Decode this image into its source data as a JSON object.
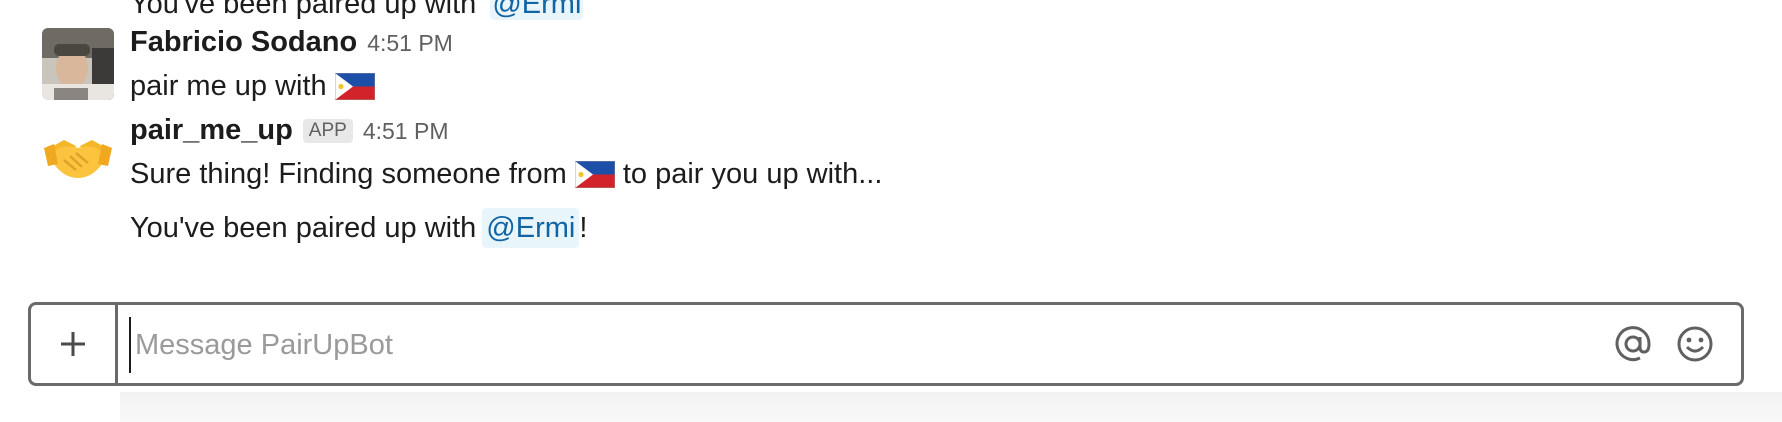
{
  "partial_message": {
    "text": "You've been paired up with",
    "mention": "@Ermi"
  },
  "messages": [
    {
      "sender": "Fabricio Sodano",
      "timestamp": "4:51 PM",
      "avatar_icon": "user-photo-avatar",
      "lines": [
        {
          "text": "pair me up with",
          "emoji": "philippines-flag"
        }
      ]
    },
    {
      "sender": "pair_me_up",
      "badge": "APP",
      "timestamp": "4:51 PM",
      "avatar_icon": "handshake-emoji",
      "lines": [
        {
          "before": "Sure thing! Finding someone from",
          "emoji": "philippines-flag",
          "after": "to pair you up with..."
        },
        {
          "before": "You've been paired up with",
          "mention": "@Ermi",
          "after": "!"
        }
      ]
    }
  ],
  "composer": {
    "placeholder": "Message PairUpBot",
    "value": "",
    "add_icon": "plus-icon",
    "mention_icon": "at-sign-icon",
    "emoji_icon": "smiley-icon"
  },
  "colors": {
    "mention": "#1264a3",
    "mention_bg": "#e8f5fa",
    "border": "#6a6a6a",
    "timestamp": "#616061"
  }
}
